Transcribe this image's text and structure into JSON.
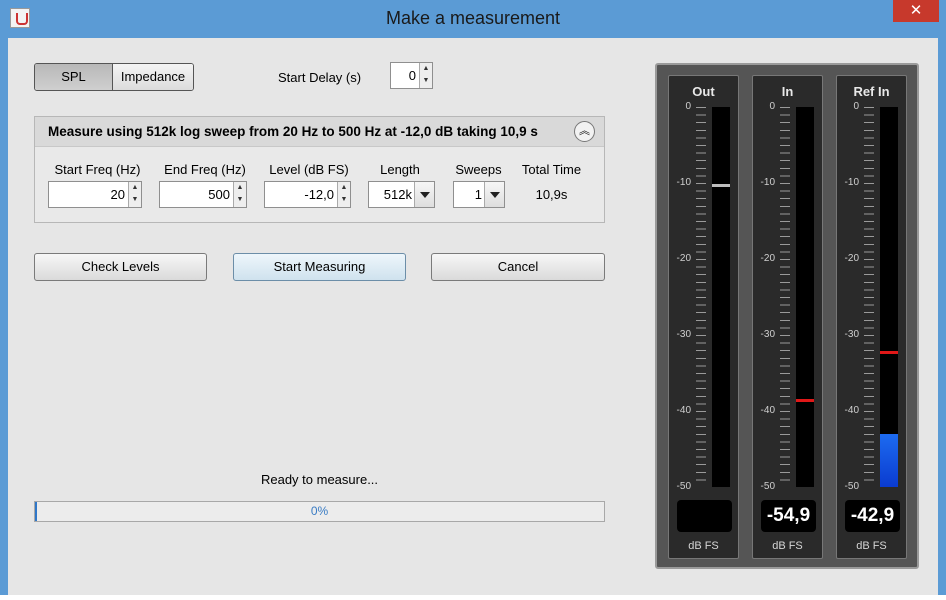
{
  "window": {
    "title": "Make a measurement",
    "close_symbol": "✕"
  },
  "mode": {
    "options": [
      "SPL",
      "Impedance"
    ],
    "selected": "SPL"
  },
  "start_delay": {
    "label": "Start Delay (s)",
    "value": "0"
  },
  "settings": {
    "title": "Measure using  512k log sweep from 20 Hz to 500 Hz at -12,0 dB taking 10,9 s",
    "start_freq": {
      "label": "Start Freq (Hz)",
      "value": "20"
    },
    "end_freq": {
      "label": "End Freq (Hz)",
      "value": "500"
    },
    "level": {
      "label": "Level (dB FS)",
      "value": "-12,0"
    },
    "length": {
      "label": "Length",
      "value": "512k"
    },
    "sweeps": {
      "label": "Sweeps",
      "value": "1"
    },
    "total_time": {
      "label": "Total Time",
      "value": "10,9s"
    }
  },
  "buttons": {
    "check_levels": "Check Levels",
    "start": "Start Measuring",
    "cancel": "Cancel"
  },
  "status": {
    "text": "Ready to measure...",
    "progress_text": "0%",
    "progress": 0
  },
  "meters": {
    "unit": "dB FS",
    "scale": [
      "0",
      "-10",
      "-20",
      "-30",
      "-40",
      "-50"
    ],
    "out": {
      "label": "Out",
      "readout": "",
      "peak_db": -10.2
    },
    "in": {
      "label": "In",
      "readout": "-54,9",
      "peak_db": -38.5
    },
    "ref_in": {
      "label": "Ref In",
      "readout": "-42,9",
      "peak_db": -32.3,
      "fill_db": -43.0
    }
  },
  "colors": {
    "peak_out": "#bdbdbd",
    "peak_red": "#e01818",
    "fill_blue": "#1d6bf0"
  }
}
